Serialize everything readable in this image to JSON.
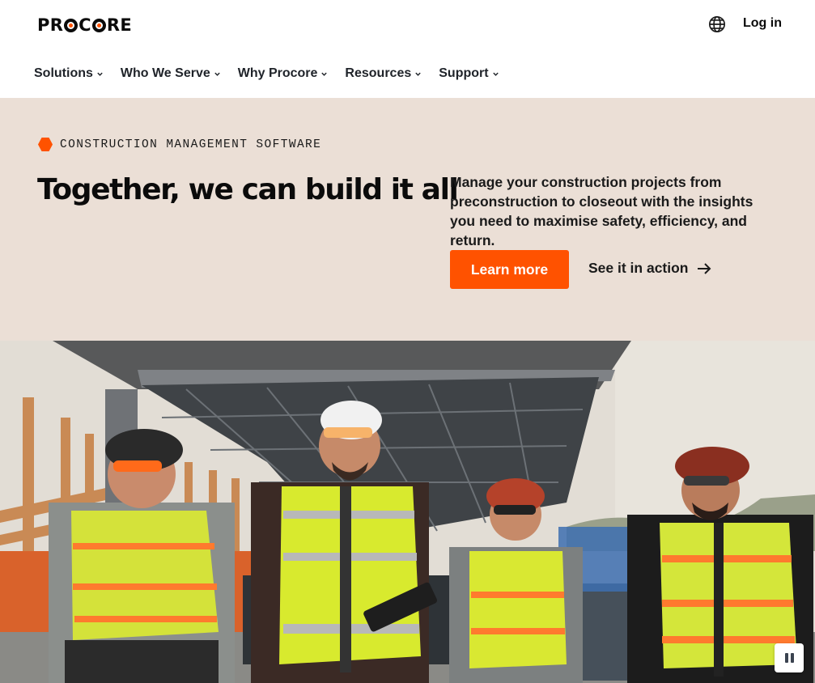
{
  "header": {
    "logo_text": "PROCORE",
    "login_label": "Log in",
    "globe_icon": "globe-icon"
  },
  "nav": {
    "items": [
      {
        "label": "Solutions"
      },
      {
        "label": "Who We Serve"
      },
      {
        "label": "Why Procore"
      },
      {
        "label": "Resources"
      },
      {
        "label": "Support"
      }
    ],
    "chevron_icon": "chevron-down-icon"
  },
  "hero": {
    "eyebrow": "CONSTRUCTION MANAGEMENT SOFTWARE",
    "headline": "Together, we can build it all",
    "subtext": "Manage your construction projects from preconstruction to closeout with the insights you need to maximise safety, efficiency, and return.",
    "primary_cta": "Learn more",
    "secondary_cta": "See it in action",
    "arrow_icon": "arrow-right-icon"
  },
  "media": {
    "pause_icon": "pause-icon"
  },
  "colors": {
    "brand_orange": "#ff5200",
    "hero_bg": "#ebdfd6",
    "text_dark": "#0b0b0b"
  }
}
